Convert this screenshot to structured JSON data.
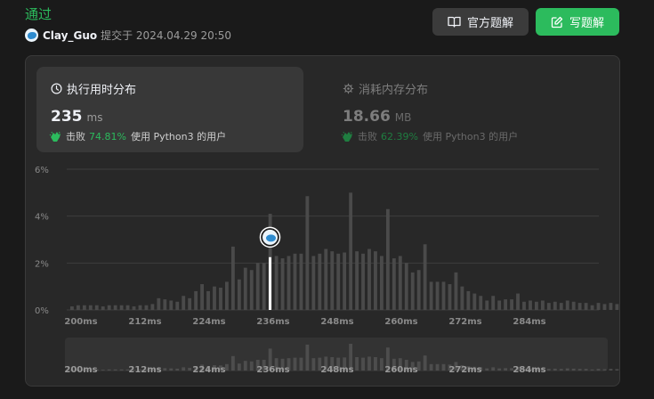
{
  "header": {
    "status": "通过",
    "username": "Clay_Guo",
    "submitted_text": "提交于 2024.04.29 20:50"
  },
  "buttons": {
    "official_solution": "官方题解",
    "write_solution": "写题解"
  },
  "runtime": {
    "title": "执行用时分布",
    "value": "235",
    "unit": "ms",
    "beat_label": "击败",
    "beat_pct": "74.81%",
    "beat_suffix": "使用 Python3 的用户"
  },
  "memory": {
    "title": "消耗内存分布",
    "value": "18.66",
    "unit": "MB",
    "beat_label": "击败",
    "beat_pct": "62.39%",
    "beat_suffix": "使用 Python3 的用户"
  },
  "colors": {
    "accent_green": "#2cbb5d",
    "bar": "#4a4a4a",
    "highlight_bar": "#ffffff"
  },
  "chart_data": {
    "type": "bar",
    "ylim": [
      0,
      6
    ],
    "yticks": [
      "6%",
      "4%",
      "2%",
      "0%"
    ],
    "ytick_values": [
      6,
      4,
      2,
      0
    ],
    "xticks": [
      "200ms",
      "212ms",
      "224ms",
      "236ms",
      "248ms",
      "260ms",
      "272ms",
      "284ms"
    ],
    "xtick_values": [
      200,
      212,
      224,
      236,
      248,
      260,
      272,
      284
    ],
    "x_min": 198,
    "x_max": 297,
    "bin_width": 1.16,
    "highlight_x": 235,
    "values": [
      0.15,
      0.2,
      0.2,
      0.2,
      0.2,
      0.15,
      0.2,
      0.2,
      0.2,
      0.2,
      0.15,
      0.2,
      0.2,
      0.25,
      0.5,
      0.45,
      0.4,
      0.35,
      0.6,
      0.5,
      0.8,
      1.1,
      0.8,
      1.0,
      0.95,
      1.2,
      2.7,
      1.3,
      1.8,
      1.7,
      2.0,
      2.0,
      4.1,
      2.3,
      2.2,
      2.3,
      2.4,
      2.4,
      4.85,
      2.3,
      2.4,
      2.6,
      2.5,
      2.4,
      2.45,
      5.0,
      2.5,
      2.4,
      2.6,
      2.5,
      2.3,
      4.3,
      2.2,
      2.3,
      2.0,
      1.6,
      1.7,
      2.8,
      1.2,
      1.2,
      1.2,
      1.1,
      1.6,
      1.0,
      0.8,
      0.7,
      0.6,
      0.4,
      0.6,
      0.4,
      0.45,
      0.45,
      0.7,
      0.35,
      0.4,
      0.35,
      0.4,
      0.3,
      0.35,
      0.3,
      0.4,
      0.35,
      0.3,
      0.3,
      0.2,
      0.3,
      0.25,
      0.3,
      0.25,
      0.2,
      0.3,
      0.25,
      0.2,
      0.25,
      0.2,
      0.2
    ]
  }
}
